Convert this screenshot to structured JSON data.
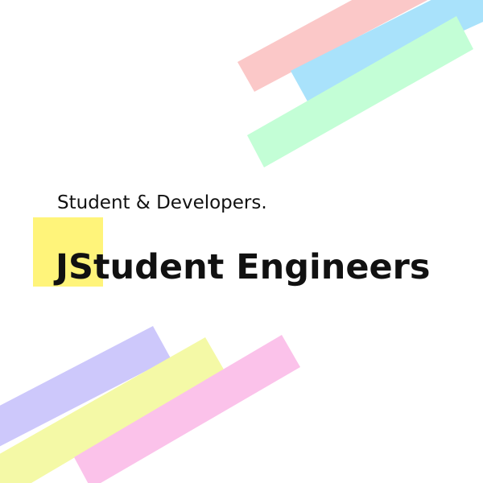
{
  "subtitle": "Student & Developers.",
  "title": "JStudent Engineers",
  "colors": {
    "background": "#ffffff",
    "text": "#111111",
    "highlight": "#fff47a",
    "stripe_pink": "#fbc8c8",
    "stripe_blue": "#a9e2fb",
    "stripe_green": "#c3fed6",
    "stripe_lavender": "#cdc8fb",
    "stripe_yellow": "#f4f9a6",
    "stripe_magenta": "#fbc2ea"
  }
}
